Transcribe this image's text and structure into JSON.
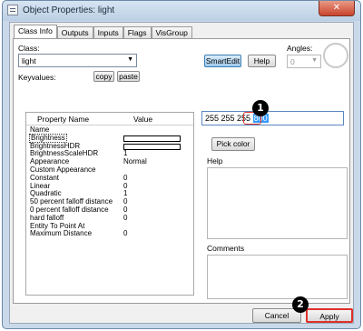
{
  "window": {
    "title": "Object Properties: light",
    "close_glyph": "✕"
  },
  "tabs": [
    {
      "label": "Class Info"
    },
    {
      "label": "Outputs"
    },
    {
      "label": "Inputs"
    },
    {
      "label": "Flags"
    },
    {
      "label": "VisGroup"
    }
  ],
  "class_info": {
    "class_label": "Class:",
    "class_value": "light",
    "keyvalues_label": "Keyvalues:",
    "copy_label": "copy",
    "paste_label": "paste",
    "smartedit_label": "SmartEdit",
    "help_button_label": "Help",
    "angles_label": "Angles:",
    "angles_value": "0"
  },
  "property_grid": {
    "col_property": "Property Name",
    "col_value": "Value",
    "rows": [
      {
        "name": "Name",
        "value": ""
      },
      {
        "name": "Brightness",
        "value": ""
      },
      {
        "name": "BrightnessHDR",
        "value": ""
      },
      {
        "name": "BrightnessScaleHDR",
        "value": "1"
      },
      {
        "name": "Appearance",
        "value": "Normal"
      },
      {
        "name": "Custom Appearance",
        "value": ""
      },
      {
        "name": "Constant",
        "value": "0"
      },
      {
        "name": "Linear",
        "value": "0"
      },
      {
        "name": "Quadratic",
        "value": "1"
      },
      {
        "name": "50 percent falloff distance",
        "value": "0"
      },
      {
        "name": "0 percent falloff distance",
        "value": "0"
      },
      {
        "name": "hard falloff",
        "value": "0"
      },
      {
        "name": "Entity To Point At",
        "value": ""
      },
      {
        "name": "Maximum Distance",
        "value": "0"
      }
    ]
  },
  "value_editor": {
    "prefix": "255 255 255 ",
    "selected": "800",
    "pick_color_label": "Pick color",
    "help_label": "Help",
    "comments_label": "Comments"
  },
  "footer": {
    "cancel_label": "Cancel",
    "apply_label": "Apply"
  },
  "markers": {
    "m1": "1",
    "m2": "2"
  },
  "colors": {
    "highlight_red": "#e0302a",
    "selection_blue": "#3399ff",
    "smartedit_blue": "#9fc8ea"
  }
}
